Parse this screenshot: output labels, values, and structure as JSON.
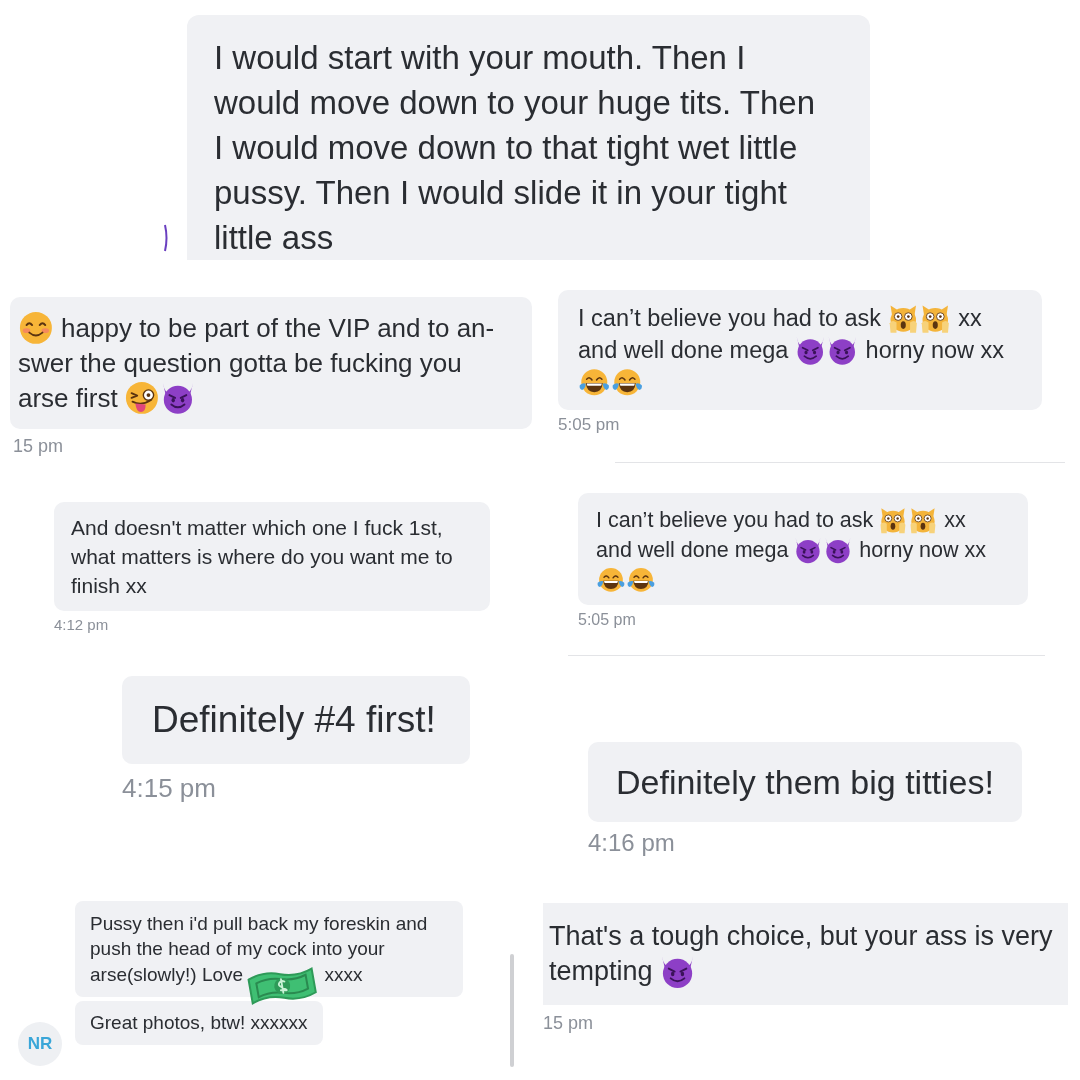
{
  "top_message": {
    "text": "I would start with your mouth. Then I\nwould move down to your huge tits. Then\nI would move down to that tight wet little\npussy. Then I would slide it in your tight\nlittle ass"
  },
  "left_column": [
    {
      "messages": [
        {
          "lines": [
            [
              {
                "kind": "smile"
              },
              {
                "kind": "text",
                "text": "happy to be part of the VIP and to an-"
              }
            ],
            [
              {
                "kind": "text",
                "text": "swer the question gotta be fucking you"
              }
            ],
            [
              {
                "kind": "text",
                "text": "arse first"
              },
              {
                "kind": "wink_tongue"
              },
              {
                "kind": "devil"
              }
            ]
          ]
        }
      ],
      "time": "15 pm"
    },
    {
      "messages": [
        {
          "text": "And doesn't matter which one I fuck 1st,\nwhat matters is where do you want me to\nfinish xx"
        }
      ],
      "time": "4:12 pm"
    },
    {
      "messages": [
        {
          "text": "Definitely #4 first!"
        }
      ],
      "time": "4:15 pm"
    },
    {
      "avatar": "NR",
      "messages": [
        {
          "lines": [
            [
              {
                "kind": "text",
                "text": "Pussy then i'd pull back my foreskin and"
              }
            ],
            [
              {
                "kind": "text",
                "text": "push the head of my cock into your"
              }
            ],
            [
              {
                "kind": "text",
                "text": "arse(slowly!) Love"
              },
              {
                "kind": "banknote"
              },
              {
                "kind": "text",
                "text": "xxxx"
              }
            ]
          ]
        },
        {
          "text": "Great photos, btw! xxxxxx"
        }
      ]
    }
  ],
  "right_column": [
    {
      "messages": [
        {
          "lines": [
            [
              {
                "kind": "text",
                "text": "I can’t believe you had to ask"
              },
              {
                "kind": "scream_cat"
              },
              {
                "kind": "scream_cat"
              },
              {
                "kind": "text",
                "text": "xx"
              }
            ],
            [
              {
                "kind": "text",
                "text": "and well done mega"
              },
              {
                "kind": "devil"
              },
              {
                "kind": "devil"
              },
              {
                "kind": "text",
                "text": "horny now xx"
              }
            ],
            [
              {
                "kind": "tears_joy"
              },
              {
                "kind": "tears_joy"
              }
            ]
          ]
        }
      ],
      "time": "5:05 pm"
    },
    {
      "messages": [
        {
          "lines": [
            [
              {
                "kind": "text",
                "text": "I can’t believe you had to ask"
              },
              {
                "kind": "scream_cat"
              },
              {
                "kind": "scream_cat"
              },
              {
                "kind": "text",
                "text": "xx"
              }
            ],
            [
              {
                "kind": "text",
                "text": "and well done mega"
              },
              {
                "kind": "devil"
              },
              {
                "kind": "devil"
              },
              {
                "kind": "text",
                "text": "horny now xx"
              }
            ],
            [
              {
                "kind": "tears_joy"
              },
              {
                "kind": "tears_joy"
              }
            ]
          ]
        }
      ],
      "time": "5:05 pm"
    },
    {
      "messages": [
        {
          "text": "Definitely them big titties!"
        }
      ],
      "time": "4:16 pm"
    },
    {
      "messages": [
        {
          "lines": [
            [
              {
                "kind": "text",
                "text": "That's a tough choice, but your ass is very"
              }
            ],
            [
              {
                "kind": "text",
                "text": "tempting"
              },
              {
                "kind": "devil"
              }
            ]
          ]
        }
      ],
      "time": "15 pm"
    }
  ]
}
